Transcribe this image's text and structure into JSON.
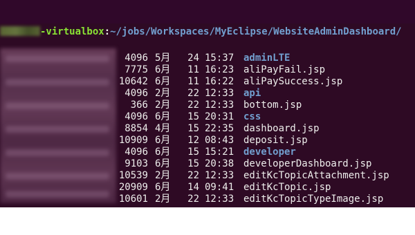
{
  "prompt": {
    "user_host_suffix": "-virtualbox",
    "colon": ":",
    "path": "~/jobs/Workspaces/MyEclipse/WebsiteAdminDashboard/"
  },
  "listing": [
    {
      "size": "4096",
      "month": "5月",
      "day": "24",
      "time": "15:37",
      "name": "adminLTE",
      "is_dir": true
    },
    {
      "size": "7775",
      "month": "6月",
      "day": "11",
      "time": "16:23",
      "name": "aliPayFail.jsp",
      "is_dir": false
    },
    {
      "size": "10642",
      "month": "6月",
      "day": "11",
      "time": "16:22",
      "name": "aliPaySuccess.jsp",
      "is_dir": false
    },
    {
      "size": "4096",
      "month": "2月",
      "day": "22",
      "time": "12:33",
      "name": "api",
      "is_dir": true
    },
    {
      "size": "366",
      "month": "2月",
      "day": "22",
      "time": "12:33",
      "name": "bottom.jsp",
      "is_dir": false
    },
    {
      "size": "4096",
      "month": "6月",
      "day": "15",
      "time": "20:31",
      "name": "css",
      "is_dir": true
    },
    {
      "size": "8854",
      "month": "4月",
      "day": "15",
      "time": "22:35",
      "name": "dashboard.jsp",
      "is_dir": false
    },
    {
      "size": "10909",
      "month": "6月",
      "day": "12",
      "time": "08:43",
      "name": "deposit.jsp",
      "is_dir": false
    },
    {
      "size": "4096",
      "month": "6月",
      "day": "15",
      "time": "15:21",
      "name": "developer",
      "is_dir": true
    },
    {
      "size": "9103",
      "month": "6月",
      "day": "15",
      "time": "20:38",
      "name": "developerDashboard.jsp",
      "is_dir": false
    },
    {
      "size": "10539",
      "month": "2月",
      "day": "22",
      "time": "12:33",
      "name": "editKcTopicAttachment.jsp",
      "is_dir": false
    },
    {
      "size": "20909",
      "month": "6月",
      "day": "14",
      "time": "09:41",
      "name": "editKcTopic.jsp",
      "is_dir": false
    },
    {
      "size": "10601",
      "month": "2月",
      "day": "22",
      "time": "12:33",
      "name": "editKcTopicTypeImage.jsp",
      "is_dir": false
    }
  ],
  "colors": {
    "background": "#2e0a24",
    "text": "#eeeeec",
    "user_host": "#8ae234",
    "directory": "#729fcf"
  }
}
